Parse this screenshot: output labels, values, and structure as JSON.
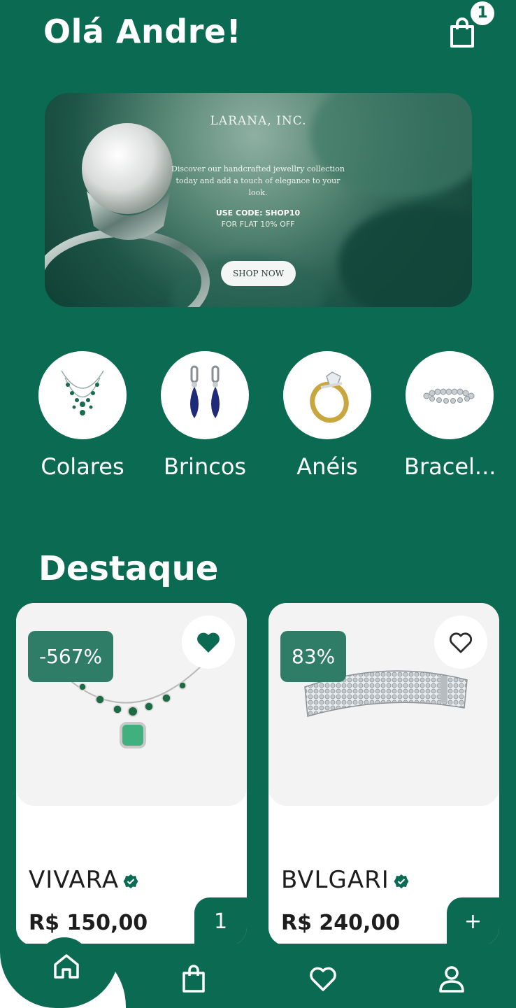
{
  "header": {
    "greeting": "Olá Andre!",
    "cart_count": "1"
  },
  "banner": {
    "brand": "LARANA, INC.",
    "description": "Discover our handcrafted jewellry collection today and add a touch of elegance to your look.",
    "code": "USE CODE: SHOP10",
    "offer": "FOR FLAT 10% OFF",
    "cta": "SHOP NOW"
  },
  "categories": [
    {
      "label": "Colares",
      "icon": "necklace-icon"
    },
    {
      "label": "Brincos",
      "icon": "earrings-icon"
    },
    {
      "label": "Anéis",
      "icon": "ring-icon"
    },
    {
      "label": "Bracel...",
      "icon": "bracelet-icon"
    }
  ],
  "featured": {
    "title": "Destaque",
    "products": [
      {
        "brand": "VIVARA",
        "price": "R$ 150,00",
        "discount": "-567%",
        "favorited": true,
        "qty_label": "1"
      },
      {
        "brand": "BVLGARI",
        "price": "R$ 240,00",
        "discount": "83%",
        "favorited": false,
        "qty_label": "+"
      }
    ]
  },
  "nav": {
    "items": [
      "home-icon",
      "bag-icon",
      "heart-icon",
      "user-icon"
    ]
  },
  "colors": {
    "primary": "#0a6a52",
    "badge": "#2f7d66",
    "card_bg": "#ffffff",
    "image_bg": "#f3f3f3"
  }
}
